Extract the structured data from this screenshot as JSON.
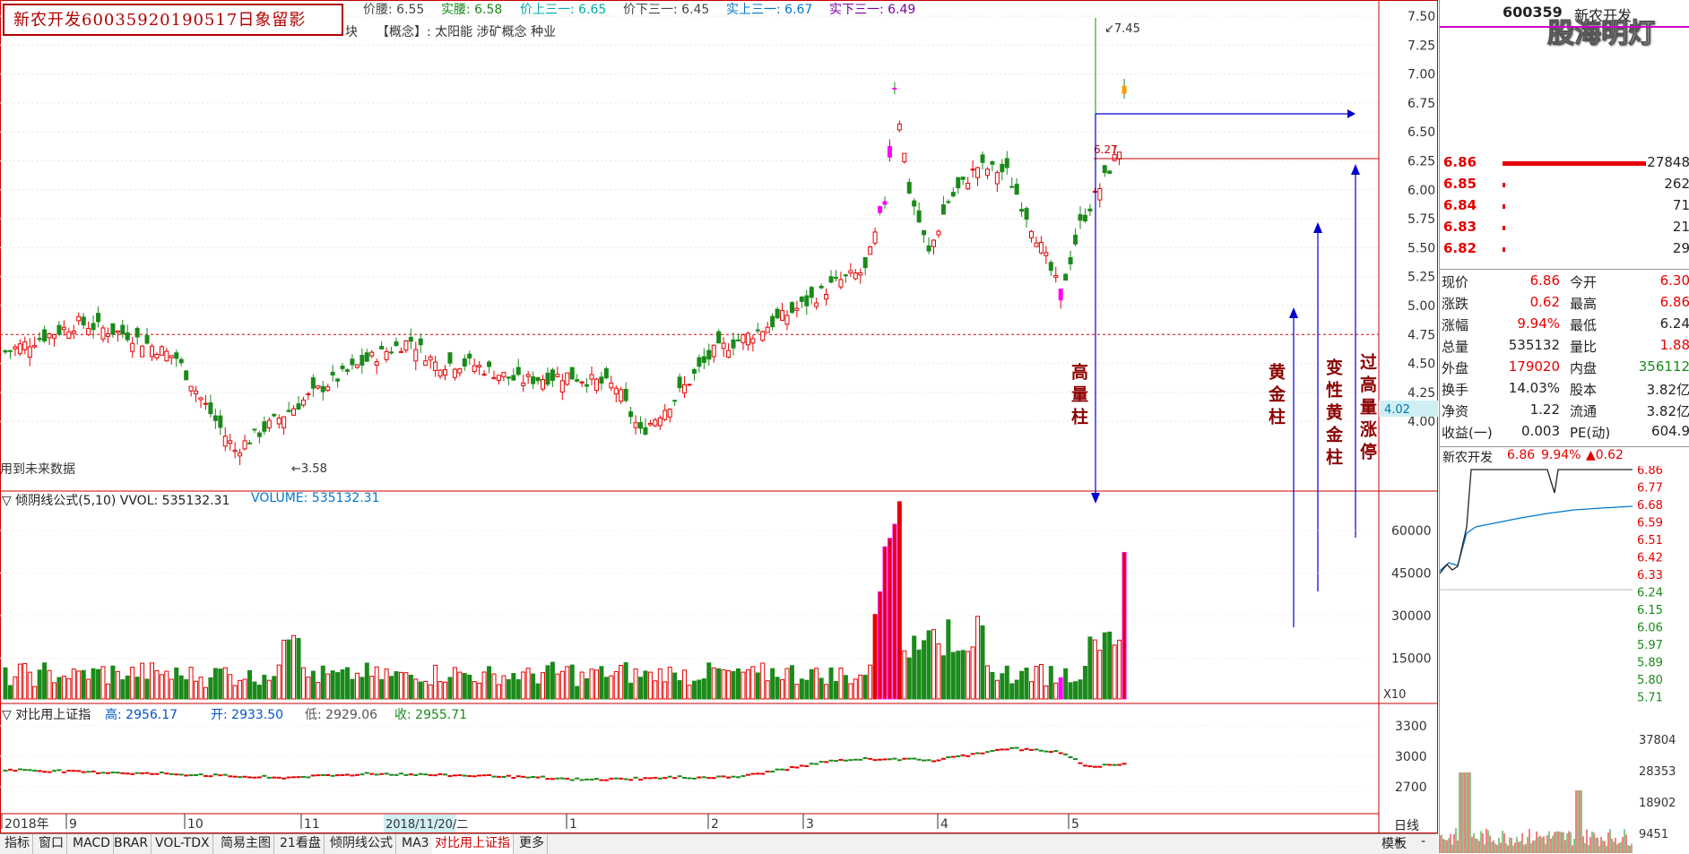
{
  "stamp_title": "新农开发60035920190517日象留影",
  "watermark": "股海明灯",
  "header": {
    "price_waist": "价腰: 6.55",
    "real_waist": "实腰: 6.58",
    "price_up": "价上三一: 6.65",
    "price_down": "价下三一: 6.45",
    "real_up": "实上三一: 6.67",
    "real_down": "实下三一: 6.49",
    "concept_prefix": "块",
    "concept": "【概念】: 太阳能 涉矿概念 种业"
  },
  "chart_notes": {
    "future_data": "用到未来数据",
    "high_mark": "7.45",
    "low_mark": "3.58",
    "level_mark": "6.27",
    "cursor_price": "4.02"
  },
  "price_axis": [
    "7.50",
    "7.25",
    "7.00",
    "6.75",
    "6.50",
    "6.25",
    "6.00",
    "5.75",
    "5.50",
    "5.25",
    "5.00",
    "4.75",
    "4.50",
    "4.25",
    "4.00"
  ],
  "annotations": {
    "high_volume": "高量柱",
    "golden": "黄金柱",
    "variant_golden": "变性黄金柱",
    "limit_up": "过高量涨停"
  },
  "volume_panel": {
    "title": "▽ 倾阴线公式(5,10) VVOL: 535132.31",
    "volume": "VOLUME: 535132.31",
    "axis": [
      "60000",
      "45000",
      "30000",
      "15000"
    ],
    "scale": "X10"
  },
  "index_panel": {
    "title": "▽ 对比用上证指",
    "high": "高: 2956.17",
    "open": "开: 2933.50",
    "low": "低: 2929.06",
    "close": "收: 2955.71",
    "axis": [
      "3300",
      "3000",
      "2700"
    ]
  },
  "time_axis": {
    "labels": [
      "2018年",
      "9",
      "10",
      "11",
      "1",
      "2",
      "3",
      "4",
      "5"
    ],
    "cursor_date": "2018/11/20/二",
    "period": "日线"
  },
  "tabs": [
    "指标",
    "窗口",
    "MACD",
    "BRAR",
    "VOL-TDX",
    "简易主图",
    "21看盘",
    "倾阴线公式",
    "MA3",
    "对比用上证指",
    "更多"
  ],
  "active_tab": "对比用上证指",
  "bottom_right": [
    "模板",
    "+",
    "-"
  ],
  "quote": {
    "code": "600359",
    "name": "新农开发",
    "asks": [
      {
        "price": "6.86",
        "vol": "27848"
      },
      {
        "price": "6.85",
        "vol": "262"
      },
      {
        "price": "6.84",
        "vol": "71"
      },
      {
        "price": "6.83",
        "vol": "21"
      },
      {
        "price": "6.82",
        "vol": "29"
      }
    ],
    "rows": [
      {
        "l1": "现价",
        "v1": "6.86",
        "l2": "今开",
        "v2": "6.30"
      },
      {
        "l1": "涨跌",
        "v1": "0.62",
        "l2": "最高",
        "v2": "6.86"
      },
      {
        "l1": "涨幅",
        "v1": "9.94%",
        "l2": "最低",
        "v2": "6.24"
      },
      {
        "l1": "总量",
        "v1": "535132",
        "l2": "量比",
        "v2": "1.88"
      },
      {
        "l1": "外盘",
        "v1": "179020",
        "l2": "内盘",
        "v2": "356112"
      },
      {
        "l1": "换手",
        "v1": "14.03%",
        "l2": "股本",
        "v2": "3.82亿"
      },
      {
        "l1": "净资",
        "v1": "1.22",
        "l2": "流通",
        "v2": "3.82亿"
      },
      {
        "l1": "收益(一)",
        "v1": "0.003",
        "l2": "PE(动)",
        "v2": "604.9"
      }
    ],
    "intraday_title": "新农开发",
    "intraday_price": "6.86",
    "intraday_pct": "9.94%",
    "intraday_chg": "▲0.62",
    "intraday_axis": [
      "6.86",
      "6.77",
      "6.68",
      "6.59",
      "6.51",
      "6.42",
      "6.33",
      "6.24",
      "6.15",
      "6.06",
      "5.97",
      "5.89",
      "5.80",
      "5.71"
    ],
    "intraday_vol_axis": [
      "37804",
      "28353",
      "18902",
      "9451"
    ]
  },
  "colors": {
    "up": "#e60000",
    "down": "#1a8a1a",
    "limit": "#ff00ff",
    "accent": "#0000cc"
  }
}
